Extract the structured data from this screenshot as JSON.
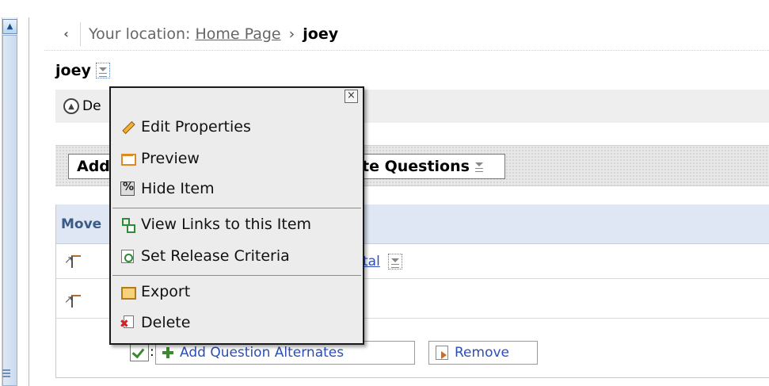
{
  "breadcrumb": {
    "prefix": "Your location:",
    "home_link": "Home Page",
    "separator": "›",
    "current": "joey"
  },
  "page": {
    "title": "joey"
  },
  "description": {
    "label": "De"
  },
  "actions": {
    "add_label": "Add",
    "create_questions_label": "te Questions"
  },
  "list": {
    "header": "Move",
    "row1_link": "tal"
  },
  "alternates": {
    "checkbox_suffix": ":",
    "add_label": "Add Question Alternates",
    "remove_label": "Remove"
  },
  "popup_menu": {
    "close_symbol": "×",
    "items": [
      {
        "label": "Edit Properties",
        "icon": "pencil-icon"
      },
      {
        "label": "Preview",
        "icon": "preview-icon"
      },
      {
        "label": "Hide Item",
        "icon": "hide-icon"
      },
      {
        "label": "View Links to this Item",
        "icon": "links-icon"
      },
      {
        "label": "Set Release Criteria",
        "icon": "release-criteria-icon"
      },
      {
        "label": "Export",
        "icon": "export-icon"
      },
      {
        "label": "Delete",
        "icon": "delete-icon"
      }
    ]
  },
  "colors": {
    "link_blue": "#2b4eb8",
    "header_blue_bg": "#dfe7f5",
    "menu_bg": "#ececec"
  }
}
